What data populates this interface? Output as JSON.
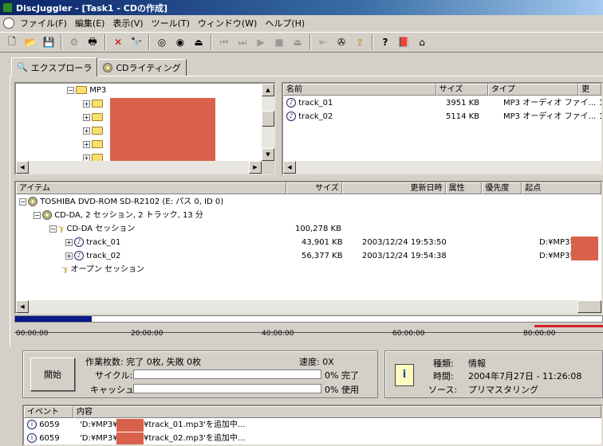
{
  "window": {
    "title": "DiscJuggler - [Task1 - CDの作成]"
  },
  "menu": [
    "ファイル(F)",
    "編集(E)",
    "表示(V)",
    "ツール(T)",
    "ウィンドウ(W)",
    "ヘルプ(H)"
  ],
  "toolbar": [
    "new-icon",
    "open-icon",
    "save-icon",
    "properties-icon",
    "print-icon",
    "delete-icon",
    "find-icon",
    "disc-add-icon",
    "disc-check-icon",
    "eject-icon",
    "prev-track-icon",
    "next-track-icon",
    "play-icon",
    "stop-icon",
    "eject-tray-icon",
    "rewind-icon",
    "record-icon",
    "folder-up-icon",
    "help-icon",
    "book-icon",
    "home-icon"
  ],
  "tabs": [
    {
      "label": "エクスプローラ",
      "icon": "search-icon"
    },
    {
      "label": "CDライティング",
      "icon": "cd-icon"
    }
  ],
  "folder_tree": {
    "root": "MP3"
  },
  "file_list": {
    "columns": [
      "名前",
      "サイズ",
      "タイプ",
      "更"
    ],
    "rows": [
      {
        "name": "track_01",
        "size": "3951 KB",
        "type": "MP3 オーディオ ファイ...",
        "mod": "1"
      },
      {
        "name": "track_02",
        "size": "5114 KB",
        "type": "MP3 オーディオ ファイ...",
        "mod": "1"
      }
    ]
  },
  "layout_tree": {
    "columns": [
      "アイテム",
      "サイズ",
      "更新日時",
      "属性",
      "優先度",
      "起点"
    ],
    "drive": "TOSHIBA DVD-ROM SD-R2102 (E: パス 0, ID 0)",
    "disc": "CD-DA, 2 セッション, 2 トラック, 13 分",
    "session": {
      "label": "CD-DA セッション",
      "size": "100,278 KB"
    },
    "tracks": [
      {
        "name": "track_01",
        "size": "43,901 KB",
        "date": "2003/12/24 19:53:50",
        "origin": "D:¥MP3¥"
      },
      {
        "name": "track_02",
        "size": "56,377 KB",
        "date": "2003/12/24 19:54:38",
        "origin": "D:¥MP3¥"
      }
    ],
    "open_session": "オープン セッション"
  },
  "timeline": {
    "ticks": [
      "00:00:00",
      "20:00:00",
      "40:00:00",
      "60:00:00",
      "80:00:00"
    ],
    "used_fraction": 0.13
  },
  "status": {
    "start_button": "開始",
    "work_label": "作業枚数: 完了 0枚, 失敗 0枚",
    "speed_label": "速度: 0X",
    "cycle_label": "サイクル:",
    "cycle_value": "0% 完了",
    "cycle_progress": 0,
    "cache_label": "キャッシュ:",
    "cache_value": "0% 使用",
    "cache_progress": 0
  },
  "info": {
    "type_label": "種類:",
    "type_value": "情報",
    "time_label": "時間:",
    "time_value": "2004年7月27日 - 11:26:08",
    "source_label": "ソース:",
    "source_value": "プリマスタリング"
  },
  "events": {
    "columns": [
      "イベント",
      "内容"
    ],
    "rows": [
      {
        "id": "6059",
        "text_a": "'D:¥MP3¥",
        "text_b": "¥track_01.mp3'を追加中..."
      },
      {
        "id": "6059",
        "text_a": "'D:¥MP3¥",
        "text_b": "¥track_02.mp3'を追加中..."
      }
    ]
  }
}
